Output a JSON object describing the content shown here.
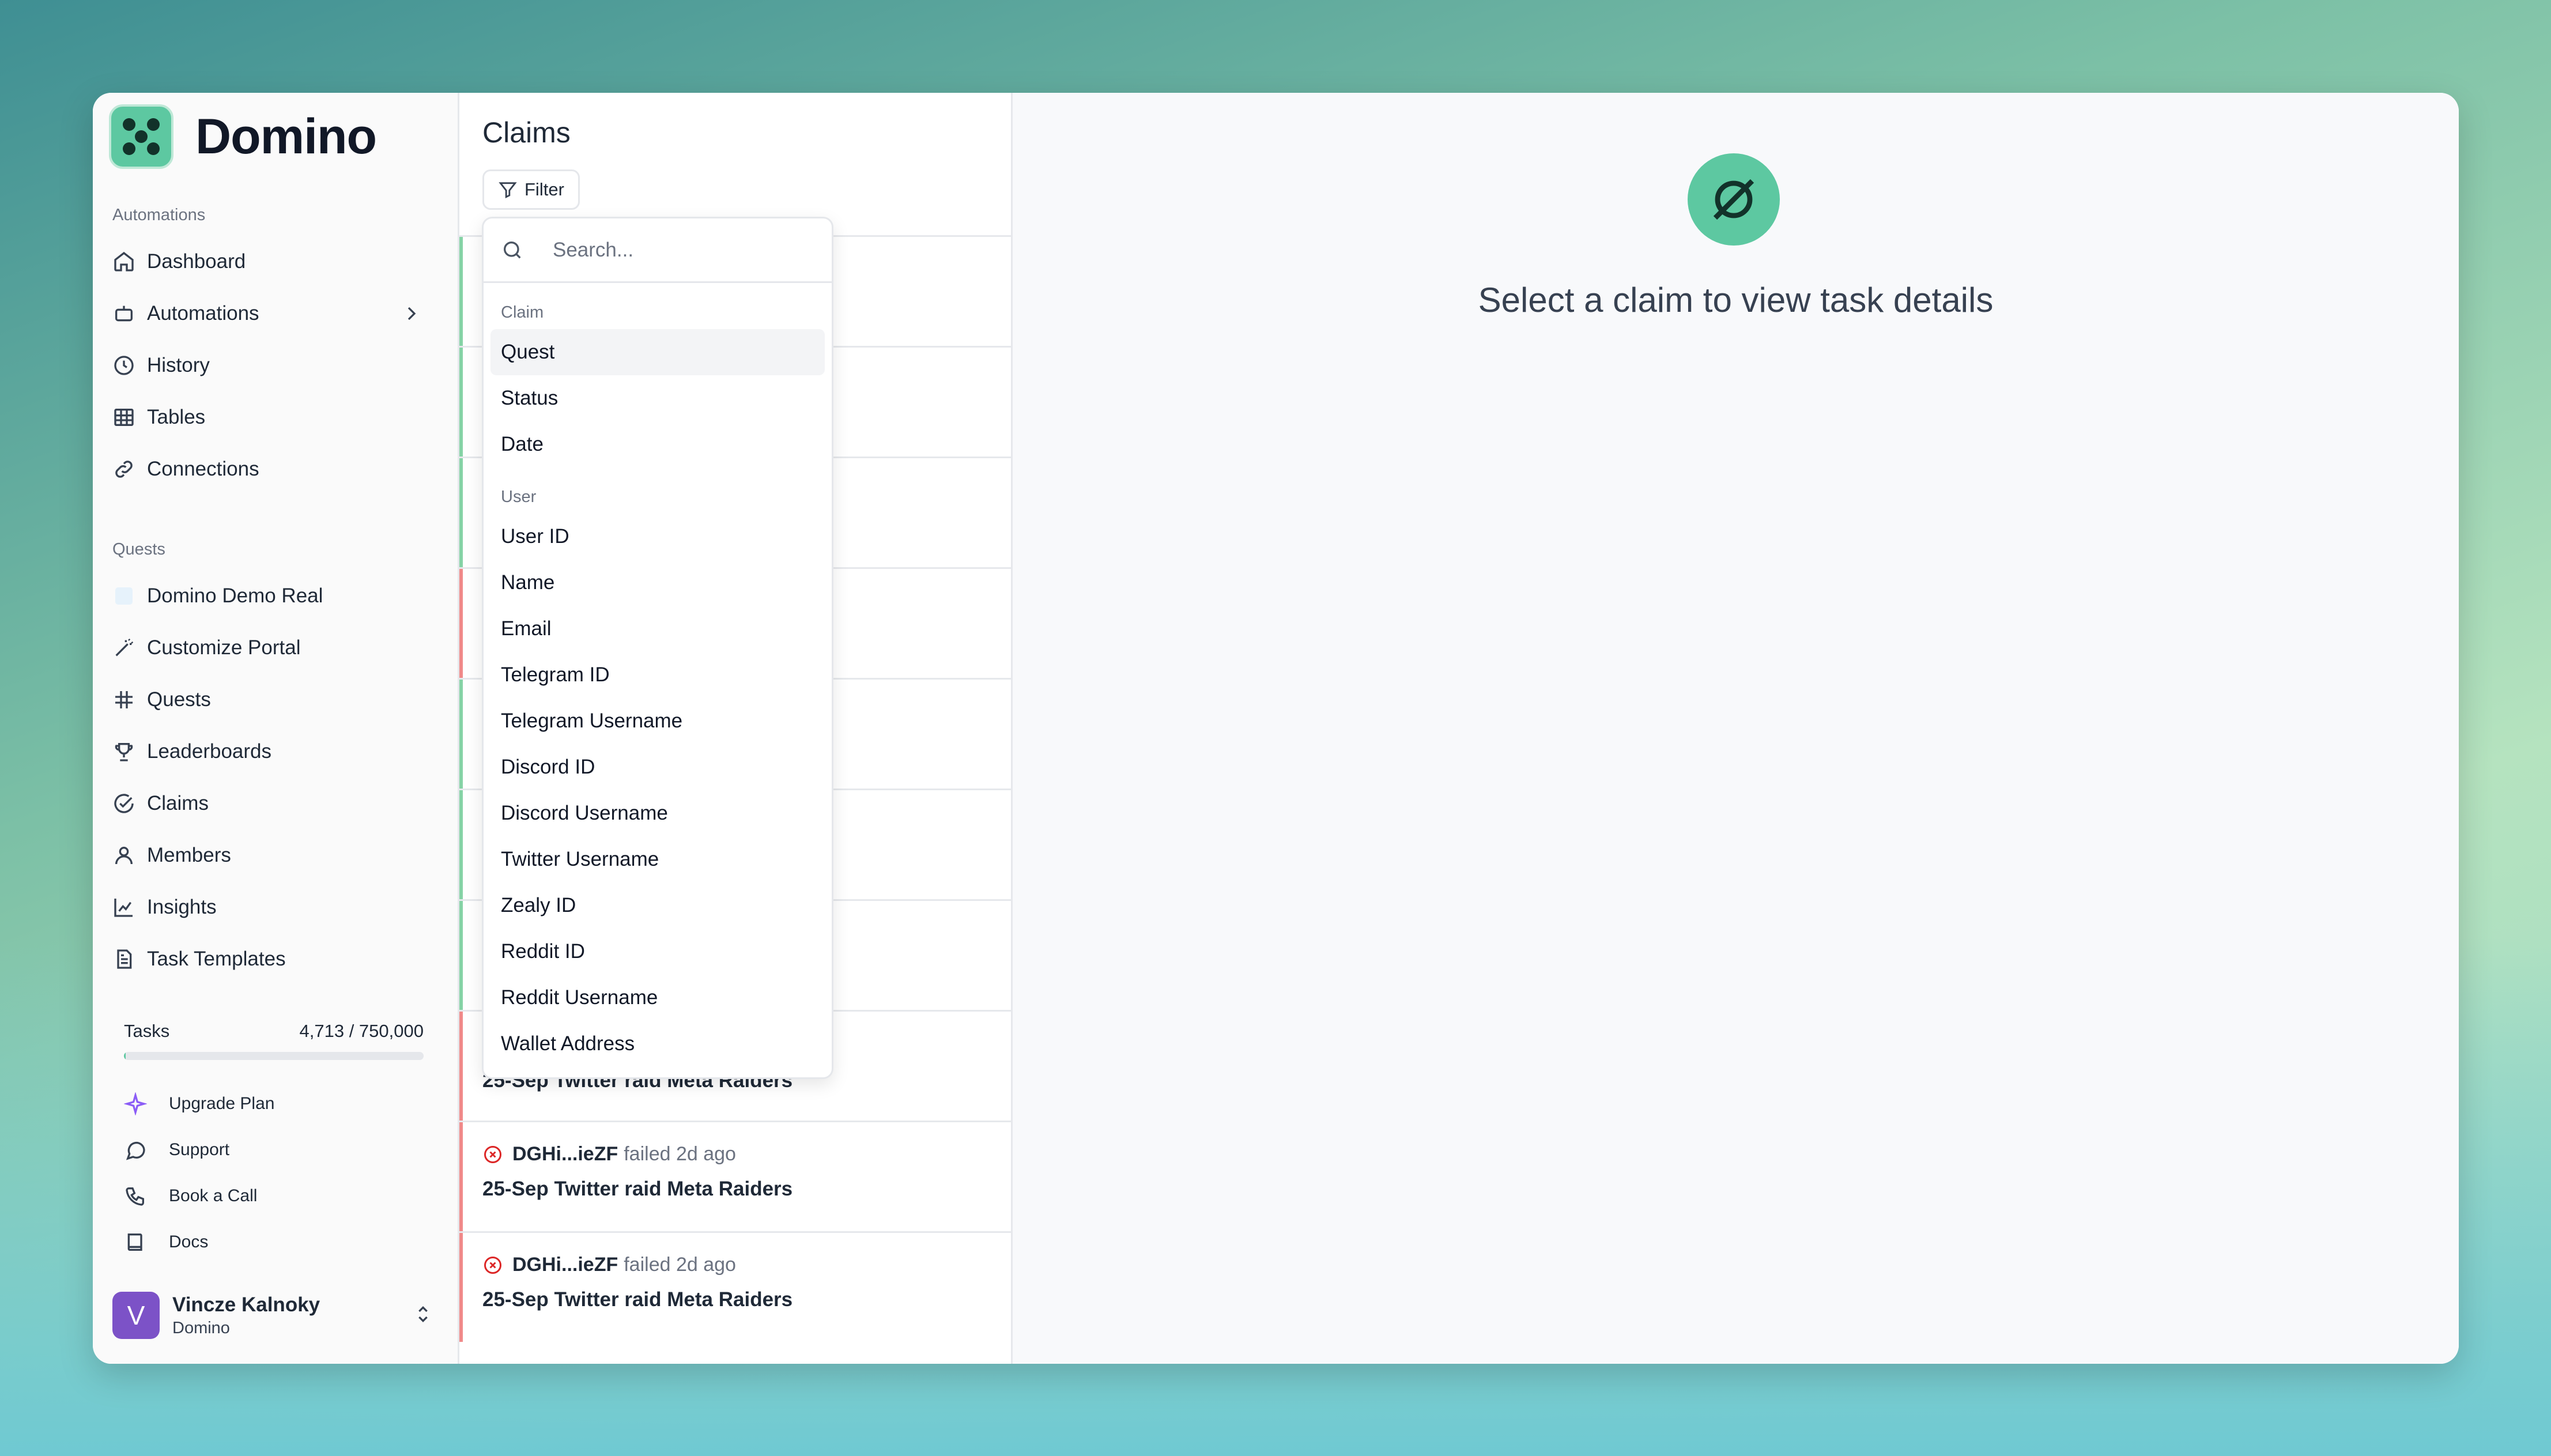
{
  "brand": {
    "name": "Domino"
  },
  "sidebar": {
    "section_automations": "Automations",
    "automations_items": [
      {
        "label": "Dashboard",
        "icon": "home-icon"
      },
      {
        "label": "Automations",
        "icon": "bot-icon"
      },
      {
        "label": "History",
        "icon": "clock-icon"
      },
      {
        "label": "Tables",
        "icon": "table-icon"
      },
      {
        "label": "Connections",
        "icon": "link-icon"
      }
    ],
    "section_quests": "Quests",
    "quests_items": [
      {
        "label": "Domino Demo Real",
        "icon": "workspace-logo-icon"
      },
      {
        "label": "Customize Portal",
        "icon": "magic-wand-icon"
      },
      {
        "label": "Quests",
        "icon": "hash-icon"
      },
      {
        "label": "Leaderboards",
        "icon": "trophy-icon"
      },
      {
        "label": "Claims",
        "icon": "check-circle-icon"
      },
      {
        "label": "Members",
        "icon": "user-icon"
      },
      {
        "label": "Insights",
        "icon": "chart-icon"
      },
      {
        "label": "Task Templates",
        "icon": "document-icon"
      }
    ],
    "tasks": {
      "label": "Tasks",
      "value": "4,713 / 750,000",
      "progress_fraction": 0.0063
    },
    "footer_items": [
      {
        "label": "Upgrade Plan",
        "icon": "sparkle-icon"
      },
      {
        "label": "Support",
        "icon": "chat-icon"
      },
      {
        "label": "Book a Call",
        "icon": "phone-icon"
      },
      {
        "label": "Docs",
        "icon": "book-icon"
      }
    ],
    "user": {
      "initial": "V",
      "name": "Vincze Kalnoky",
      "org": "Domino"
    }
  },
  "claims": {
    "title": "Claims",
    "filter_label": "Filter",
    "rows": [
      {
        "status": "approved",
        "who": "",
        "meta": "",
        "title": ""
      },
      {
        "status": "approved",
        "who": "",
        "meta": "",
        "title": ""
      },
      {
        "status": "approved",
        "who": "",
        "meta": "",
        "title": ""
      },
      {
        "status": "failed",
        "who": "",
        "meta": "",
        "title": ""
      },
      {
        "status": "approved",
        "who": "",
        "meta": "",
        "title": ""
      },
      {
        "status": "approved",
        "who": "",
        "meta": "",
        "title": ""
      },
      {
        "status": "approved",
        "who": "",
        "meta": "",
        "title": ""
      },
      {
        "status": "failed",
        "who": "",
        "meta": "",
        "title": "25-Sep Twitter raid Meta Raiders"
      },
      {
        "status": "failed",
        "who": "DGHi...ieZF",
        "meta": "failed 2d ago",
        "title": "25-Sep Twitter raid Meta Raiders"
      },
      {
        "status": "failed",
        "who": "DGHi...ieZF",
        "meta": "failed 2d ago",
        "title": "25-Sep Twitter raid Meta Raiders"
      }
    ],
    "colors": {
      "approved": "#86d3a6",
      "failed": "#f08a8a"
    }
  },
  "filter_dropdown": {
    "search_placeholder": "Search...",
    "groups": [
      {
        "label": "Claim",
        "items": [
          "Quest",
          "Status",
          "Date"
        ],
        "active": "Quest"
      },
      {
        "label": "User",
        "items": [
          "User ID",
          "Name",
          "Email",
          "Telegram ID",
          "Telegram Username",
          "Discord ID",
          "Discord Username",
          "Twitter Username",
          "Zealy ID",
          "Reddit ID",
          "Reddit Username",
          "Wallet Address"
        ]
      }
    ]
  },
  "detail": {
    "empty_message": "Select a claim to view task details",
    "icon": "empty-set-icon"
  }
}
